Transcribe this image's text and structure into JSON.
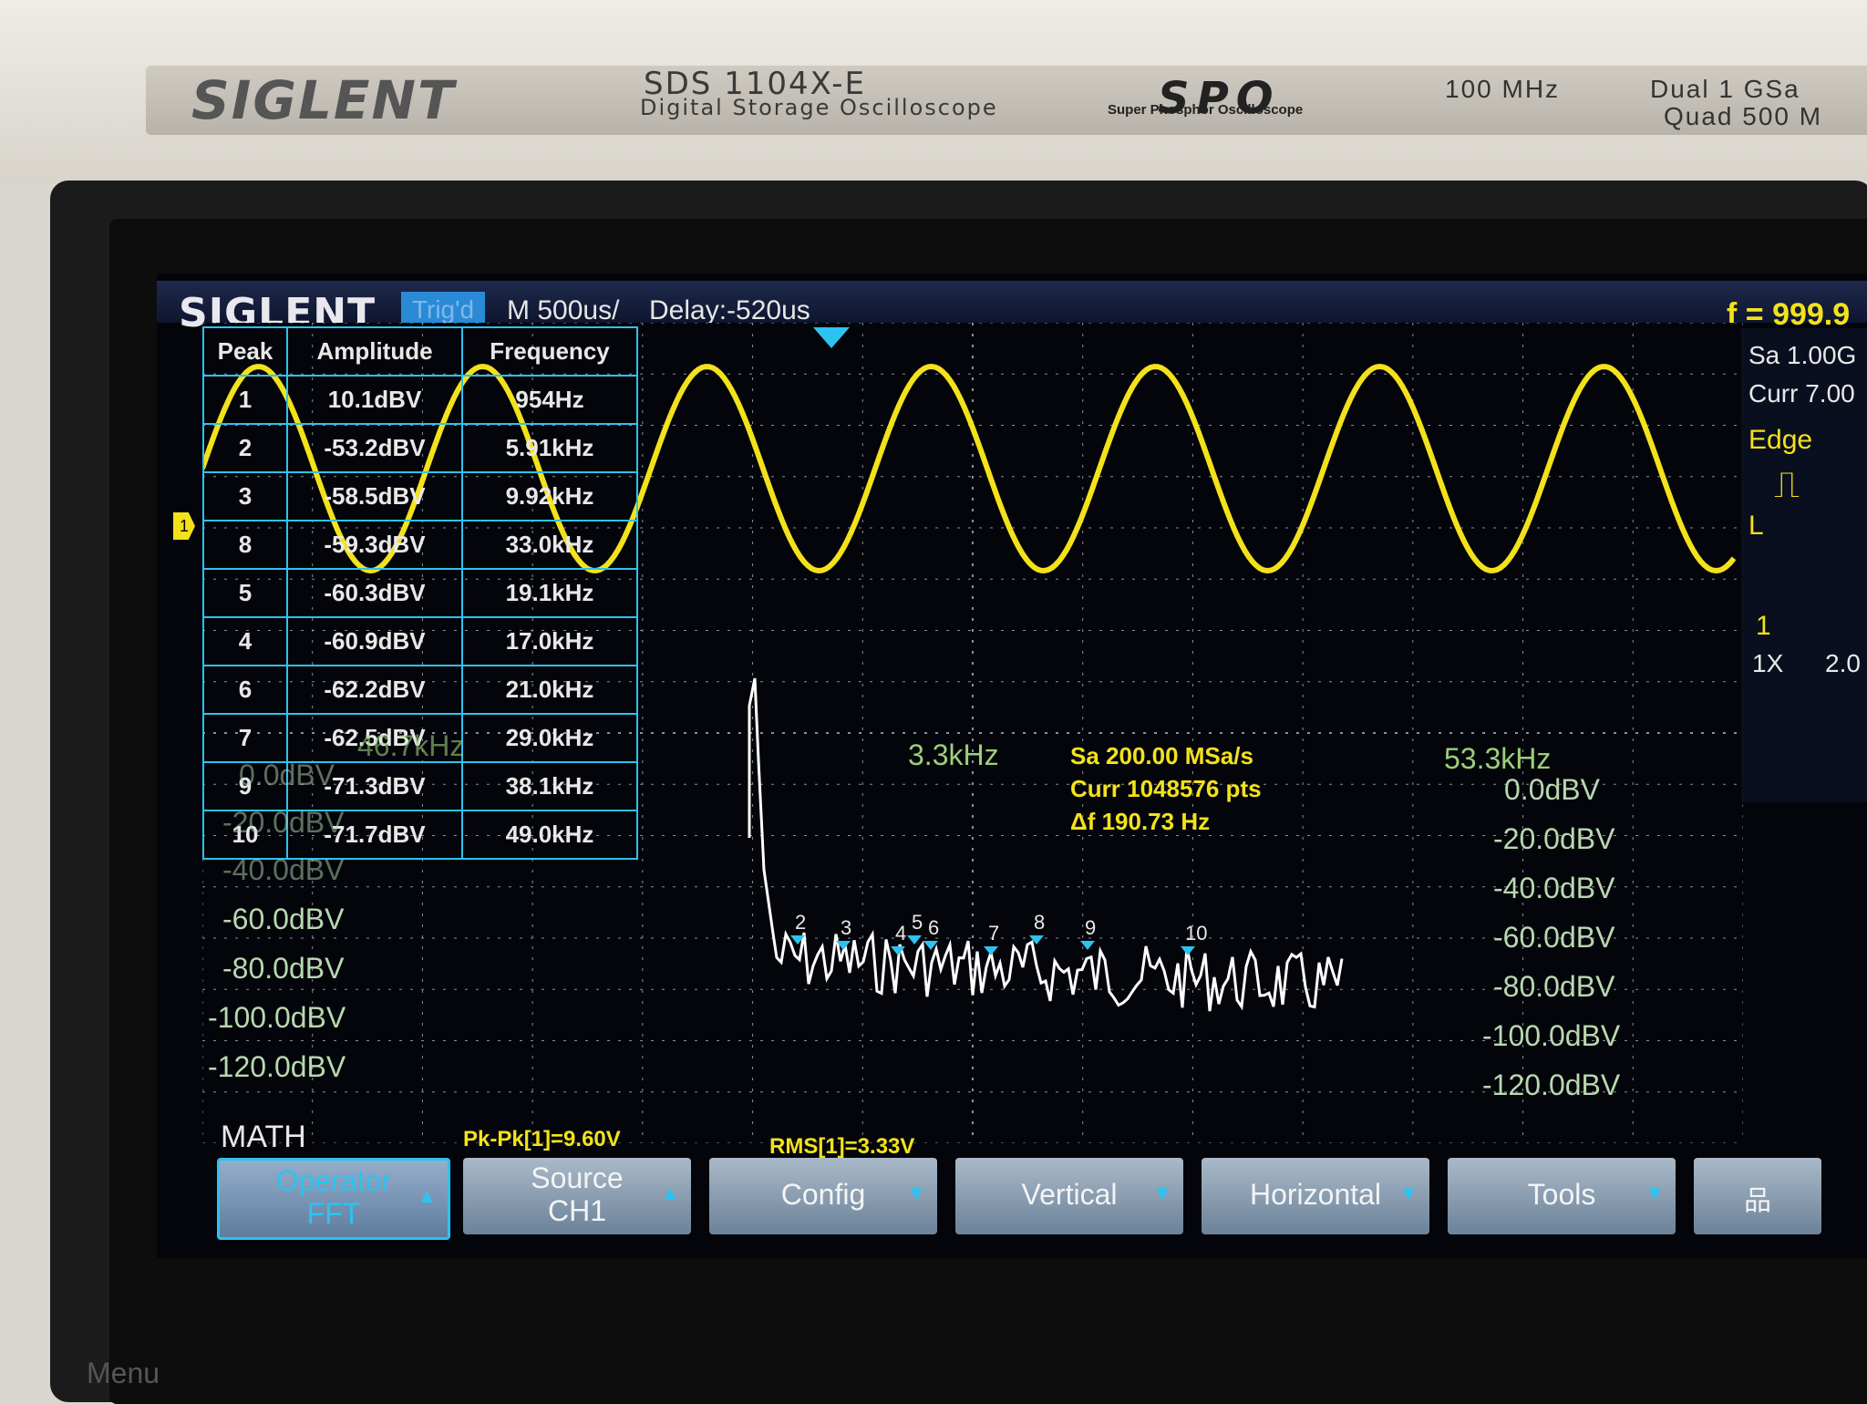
{
  "device": {
    "brand": "SIGLENT",
    "model": "SDS 1104X-E",
    "model_sub": "Digital Storage Oscilloscope",
    "spo": "SPO",
    "spo_sub": "Super Phosphor Oscilloscope",
    "bandwidth": "100 MHz",
    "spec_line1": "Dual  1 GSa",
    "spec_line2": "Quad  500 M",
    "menu_label": "Menu"
  },
  "topbar": {
    "logo": "SIGLENT",
    "trig_status": "Trig'd",
    "timebase": "M 500us/",
    "delay": "Delay:-520us",
    "frequency": "f = 999.9"
  },
  "right_panel": {
    "sa": "Sa 1.00G",
    "curr": "Curr 7.00",
    "trigger_type": "Edge",
    "slope_icon": "rising-edge-icon",
    "coupling": "L",
    "channel": "1",
    "probe": "1X",
    "ch_value": "2.0"
  },
  "peak_table": {
    "headers": [
      "Peak",
      "Amplitude",
      "Frequency"
    ],
    "rows": [
      [
        "1",
        "10.1dBV",
        "954Hz"
      ],
      [
        "2",
        "-53.2dBV",
        "5.91kHz"
      ],
      [
        "3",
        "-58.5dBV",
        "9.92kHz"
      ],
      [
        "8",
        "-59.3dBV",
        "33.0kHz"
      ],
      [
        "5",
        "-60.3dBV",
        "19.1kHz"
      ],
      [
        "4",
        "-60.9dBV",
        "17.0kHz"
      ],
      [
        "6",
        "-62.2dBV",
        "21.0kHz"
      ],
      [
        "7",
        "-62.5dBV",
        "29.0kHz"
      ],
      [
        "9",
        "-71.3dBV",
        "38.1kHz"
      ],
      [
        "10",
        "-71.7dBV",
        "49.0kHz"
      ]
    ]
  },
  "fft": {
    "start_freq": "46.7kHz",
    "center_freq": "3.3kHz",
    "end_freq": "53.3kHz",
    "sa": "Sa 200.00 MSa/s",
    "curr": "Curr 1048576 pts",
    "df": "Δf 190.73 Hz",
    "left_scale": [
      "0.0dBV",
      "-20.0dBV",
      "-40.0dBV",
      "-60.0dBV",
      "-80.0dBV",
      "-100.0dBV",
      "-120.0dBV"
    ],
    "right_scale": [
      "0.0dBV",
      "-20.0dBV",
      "-40.0dBV",
      "-60.0dBV",
      "-80.0dBV",
      "-100.0dBV",
      "-120.0dBV"
    ],
    "peak_markers": [
      "2",
      "3",
      "4",
      "5",
      "6",
      "7",
      "8",
      "9",
      "10"
    ]
  },
  "measurements": {
    "pkpk": "Pk-Pk[1]=9.60V",
    "rms": "RMS[1]=3.33V"
  },
  "math_label": "MATH",
  "softkeys": [
    {
      "line1": "Operator",
      "line2": "FFT"
    },
    {
      "line1": "Source",
      "line2": "CH1"
    },
    {
      "line1": "Config",
      "line2": ""
    },
    {
      "line1": "Vertical",
      "line2": ""
    },
    {
      "line1": "Horizontal",
      "line2": ""
    },
    {
      "line1": "Tools",
      "line2": ""
    }
  ],
  "colors": {
    "ch1": "#f3e21a",
    "fft_trace": "#ffffff",
    "table_border": "#2ec2f0",
    "grid": "#8a8f99"
  }
}
